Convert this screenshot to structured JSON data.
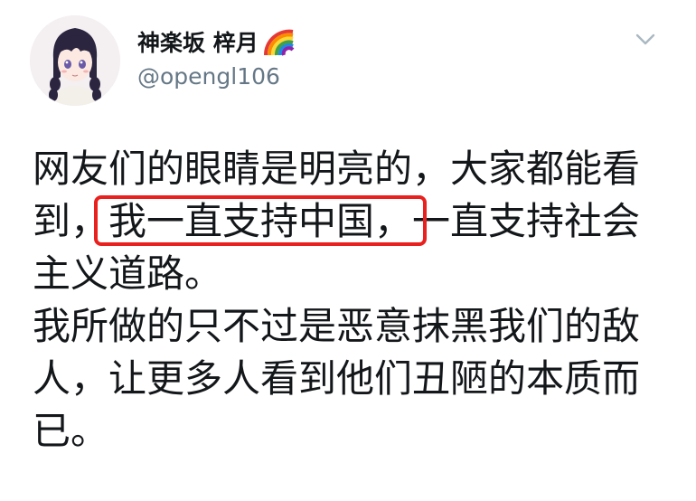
{
  "author": {
    "display_name": "神楽坂 梓月",
    "rainbow_icon": "rainbow-emoji",
    "handle": "@opengl106",
    "avatar_icon": "anime-girl-avatar"
  },
  "menu": {
    "icon": "chevron-down-icon"
  },
  "tweet": {
    "p1_line1": "网友们的眼睛是明亮的，大家都能看",
    "p1_line2_before": "到，",
    "p1_line2_highlight": "我一直支持中国，",
    "p1_line2_after": "一直支持社会",
    "p1_line3": "主义道路。",
    "p2_line1": "我所做的只不过是恶意抹黑我们的敌",
    "p2_line2": "人，让更多人看到他们丑陋的本质而",
    "p2_line3": "已。"
  },
  "colors": {
    "text": "#14171a",
    "secondary": "#657786",
    "highlight_border": "#e8201e"
  }
}
